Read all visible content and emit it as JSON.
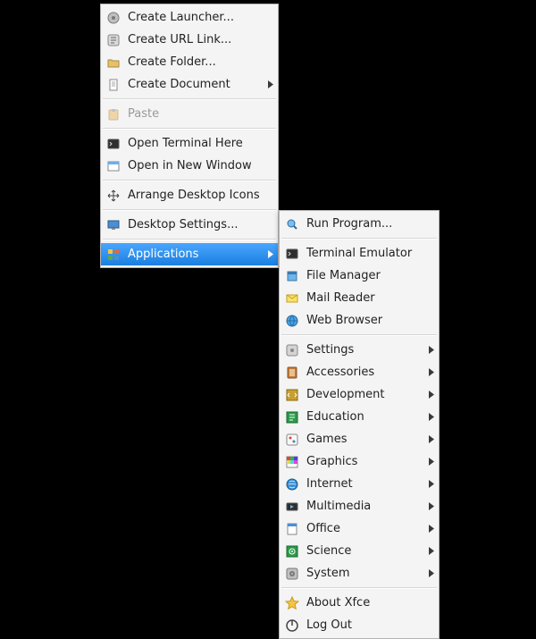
{
  "main_menu": {
    "create_launcher": "Create Launcher...",
    "create_url_link": "Create URL Link...",
    "create_folder": "Create Folder...",
    "create_document": "Create Document",
    "paste": "Paste",
    "open_terminal_here": "Open Terminal Here",
    "open_in_new_window": "Open in New Window",
    "arrange_desktop_icons": "Arrange Desktop Icons",
    "desktop_settings": "Desktop Settings...",
    "applications": "Applications"
  },
  "sub_menu": {
    "run_program": "Run Program...",
    "terminal_emulator": "Terminal Emulator",
    "file_manager": "File Manager",
    "mail_reader": "Mail Reader",
    "web_browser": "Web Browser",
    "settings": "Settings",
    "accessories": "Accessories",
    "development": "Development",
    "education": "Education",
    "games": "Games",
    "graphics": "Graphics",
    "internet": "Internet",
    "multimedia": "Multimedia",
    "office": "Office",
    "science": "Science",
    "system": "System",
    "about_xfce": "About Xfce",
    "log_out": "Log Out"
  }
}
